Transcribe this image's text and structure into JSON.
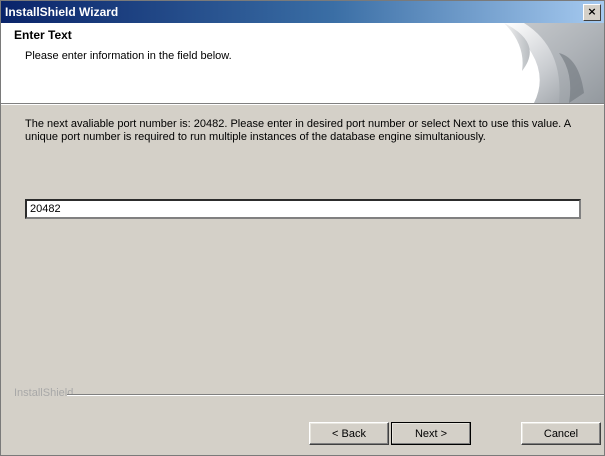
{
  "window": {
    "title": "InstallShield Wizard",
    "close_glyph": "×"
  },
  "header": {
    "title": "Enter Text",
    "subtitle": "Please enter information in the field below."
  },
  "body": {
    "description": "The next avaliable port number is: 20482.  Please enter in desired port number or select Next to use this value. A unique port number is required to run multiple instances of the database engine simultaniously.",
    "port_value": "20482"
  },
  "footer": {
    "brand": "InstallShield",
    "back_label": "< Back",
    "next_label": "Next >",
    "cancel_label": "Cancel"
  },
  "colors": {
    "titlebar_start": "#0a246a",
    "titlebar_end": "#a6caf0",
    "dialog_bg": "#d4d0c8"
  },
  "icons": [
    "close-icon",
    "page-curl-art"
  ]
}
